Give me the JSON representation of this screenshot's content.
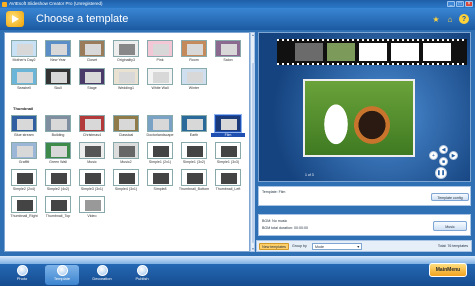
{
  "window": {
    "title": "AVIEsoft Slideshow Creator Pro (Unregistered)",
    "buttons": [
      "_",
      "□",
      "×"
    ]
  },
  "header": {
    "title": "Choose a template",
    "icons": [
      "star-icon",
      "home-icon",
      "help-icon"
    ]
  },
  "templates": {
    "row1": [
      "Mother's Day2",
      "New Year",
      "Closet",
      "Originality3",
      "Pink",
      "Room",
      "Salon"
    ],
    "row2": [
      "Seashell",
      "Skull",
      "Stage",
      "Wedding1",
      "White Wall",
      "Winter"
    ],
    "section_label": "Thumbnail",
    "row3": [
      "Blue stream",
      "Building",
      "Christmas4",
      "Classical",
      "Doctorlandscape",
      "Earth",
      "Film"
    ],
    "row4": [
      "Graffiti",
      "Green Wall",
      "Music",
      "Music2",
      "Simple1 (2x1)",
      "Simple1 (3x2)",
      "Simple1 (3x3)"
    ],
    "row5": [
      "Simple2 (2x4)",
      "Simple2 (4x2)",
      "Simple3 (3x1)",
      "Simple4 (3x1)",
      "Simple8",
      "Thumbnail_Bottom",
      "Thumbnail_Left"
    ],
    "row6": [
      "Thumbnail_Right",
      "Thumbnail_Top",
      "Video"
    ],
    "selected": "Film"
  },
  "preview": {
    "counter": "1 of 3",
    "template_label": "Template: Film",
    "config_button": "Template config"
  },
  "music": {
    "line1": "BGM: No music",
    "line2": "BGM total duration: 00:00:00",
    "button": "Music"
  },
  "filter": {
    "new_templates": "New templates",
    "group_by_label": "Group by",
    "group_by_value": "Mode",
    "total": "Total: 76 templates"
  },
  "tabs": [
    {
      "label": "Photo",
      "active": false
    },
    {
      "label": "Template",
      "active": true
    },
    {
      "label": "Decoration",
      "active": false
    },
    {
      "label": "Publish",
      "active": false
    }
  ],
  "main_menu": "MainMenu"
}
